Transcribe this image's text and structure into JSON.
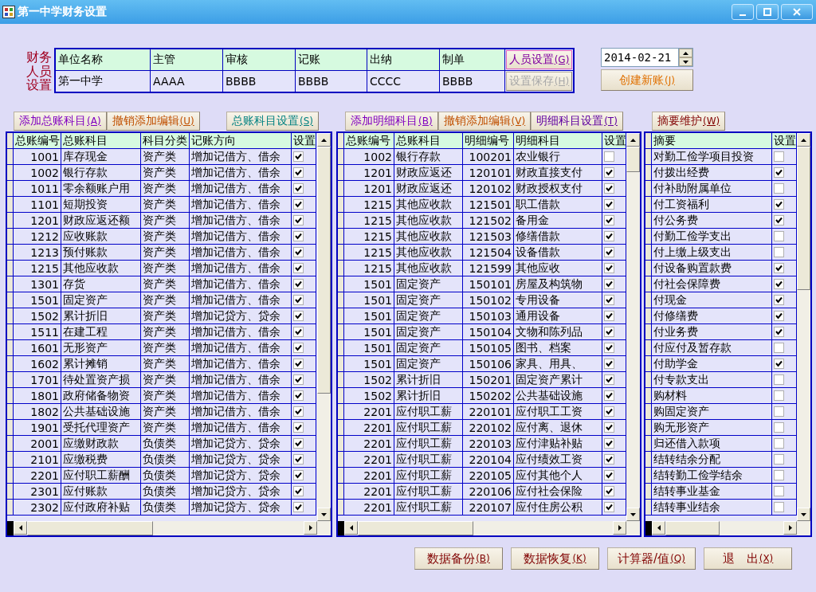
{
  "window": {
    "title": "第一中学财务设置"
  },
  "staff": {
    "label": "财务人员设置",
    "columns": [
      "单位名称",
      "主管",
      "审核",
      "记账",
      "出纳",
      "制单"
    ],
    "values": [
      "第一中学",
      "AAAA",
      "BBBB",
      "BBBB",
      "CCCC",
      "BBBB"
    ],
    "buttons": [
      {
        "label": "人员设置",
        "accel": "(G)",
        "disabled": false,
        "color": "#8000a0"
      },
      {
        "label": "设置保存",
        "accel": "(H)",
        "disabled": true
      }
    ]
  },
  "date": {
    "value": "2014-02-21"
  },
  "create_button": {
    "label": "创建新账",
    "accel": "(J)",
    "color": "#e07000"
  },
  "grids": [
    {
      "buttons": [
        {
          "label": "添加总账科目",
          "accel": "(A)",
          "color": "#8000c0"
        },
        {
          "label": "撤销添加编辑",
          "accel": "(U)",
          "color": "#c05000"
        },
        {
          "label": "总账科目设置",
          "accel": "(S)",
          "color": "#008080"
        }
      ],
      "columns": [
        "总账编号",
        "总账科目",
        "科目分类",
        "记账方向",
        "设置"
      ],
      "rows": [
        {
          "cells": [
            "1001",
            "库存现金",
            "资产类",
            "增加记借方、借余"
          ],
          "checked": true
        },
        {
          "cells": [
            "1002",
            "银行存款",
            "资产类",
            "增加记借方、借余"
          ],
          "checked": true
        },
        {
          "cells": [
            "1011",
            "零余额账户用",
            "资产类",
            "增加记借方、借余"
          ],
          "checked": true
        },
        {
          "cells": [
            "1101",
            "短期投资",
            "资产类",
            "增加记借方、借余"
          ],
          "checked": true
        },
        {
          "cells": [
            "1201",
            "财政应返还额",
            "资产类",
            "增加记借方、借余"
          ],
          "checked": true
        },
        {
          "cells": [
            "1212",
            "应收账款",
            "资产类",
            "增加记借方、借余"
          ],
          "checked": true
        },
        {
          "cells": [
            "1213",
            "预付账款",
            "资产类",
            "增加记借方、借余"
          ],
          "checked": true
        },
        {
          "cells": [
            "1215",
            "其他应收款",
            "资产类",
            "增加记借方、借余"
          ],
          "checked": true
        },
        {
          "cells": [
            "1301",
            "存货",
            "资产类",
            "增加记借方、借余"
          ],
          "checked": true
        },
        {
          "cells": [
            "1501",
            "固定资产",
            "资产类",
            "增加记借方、借余"
          ],
          "checked": true
        },
        {
          "cells": [
            "1502",
            "累计折旧",
            "资产类",
            "增加记贷方、贷余"
          ],
          "checked": true
        },
        {
          "cells": [
            "1511",
            "在建工程",
            "资产类",
            "增加记借方、借余"
          ],
          "checked": true
        },
        {
          "cells": [
            "1601",
            "无形资产",
            "资产类",
            "增加记借方、借余"
          ],
          "checked": true
        },
        {
          "cells": [
            "1602",
            "累计摊销",
            "资产类",
            "增加记借方、借余"
          ],
          "checked": true
        },
        {
          "cells": [
            "1701",
            "待处置资产损",
            "资产类",
            "增加记借方、借余"
          ],
          "checked": true
        },
        {
          "cells": [
            "1801",
            "政府储备物资",
            "资产类",
            "增加记借方、借余"
          ],
          "checked": true
        },
        {
          "cells": [
            "1802",
            "公共基础设施",
            "资产类",
            "增加记借方、借余"
          ],
          "checked": true
        },
        {
          "cells": [
            "1901",
            "受托代理资产",
            "资产类",
            "增加记借方、借余"
          ],
          "checked": true
        },
        {
          "cells": [
            "2001",
            "应缴财政款",
            "负债类",
            "增加记贷方、贷余"
          ],
          "checked": true
        },
        {
          "cells": [
            "2101",
            "应缴税费",
            "负债类",
            "增加记贷方、贷余"
          ],
          "checked": true
        },
        {
          "cells": [
            "2201",
            "应付职工薪酬",
            "负债类",
            "增加记贷方、贷余"
          ],
          "checked": true
        },
        {
          "cells": [
            "2301",
            "应付账款",
            "负债类",
            "增加记贷方、贷余"
          ],
          "checked": true
        },
        {
          "cells": [
            "2302",
            "应付政府补贴",
            "负债类",
            "增加记贷方、贷余"
          ],
          "checked": true
        }
      ]
    },
    {
      "buttons": [
        {
          "label": "添加明细科目",
          "accel": "(B)",
          "color": "#8000c0"
        },
        {
          "label": "撤销添加编辑",
          "accel": "(V)",
          "color": "#c05000"
        },
        {
          "label": "明细科目设置",
          "accel": "(T)",
          "color": "#6000a0"
        }
      ],
      "columns": [
        "总账编号",
        "总账科目",
        "明细编号",
        "明细科目",
        "设置"
      ],
      "rows": [
        {
          "cells": [
            "1002",
            "银行存款",
            "100201",
            "农业银行"
          ],
          "checked": false
        },
        {
          "cells": [
            "1201",
            "财政应返还",
            "120101",
            "财政直接支付"
          ],
          "checked": true
        },
        {
          "cells": [
            "1201",
            "财政应返还",
            "120102",
            "财政授权支付"
          ],
          "checked": true
        },
        {
          "cells": [
            "1215",
            "其他应收款",
            "121501",
            "职工借款"
          ],
          "checked": true
        },
        {
          "cells": [
            "1215",
            "其他应收款",
            "121502",
            "备用金"
          ],
          "checked": true
        },
        {
          "cells": [
            "1215",
            "其他应收款",
            "121503",
            "修缮借款"
          ],
          "checked": true
        },
        {
          "cells": [
            "1215",
            "其他应收款",
            "121504",
            "设备借款"
          ],
          "checked": true
        },
        {
          "cells": [
            "1215",
            "其他应收款",
            "121599",
            "其他应收"
          ],
          "checked": true
        },
        {
          "cells": [
            "1501",
            "固定资产",
            "150101",
            "房屋及构筑物"
          ],
          "checked": true
        },
        {
          "cells": [
            "1501",
            "固定资产",
            "150102",
            "专用设备"
          ],
          "checked": true
        },
        {
          "cells": [
            "1501",
            "固定资产",
            "150103",
            "通用设备"
          ],
          "checked": true
        },
        {
          "cells": [
            "1501",
            "固定资产",
            "150104",
            "文物和陈列品"
          ],
          "checked": true
        },
        {
          "cells": [
            "1501",
            "固定资产",
            "150105",
            "图书、档案"
          ],
          "checked": true
        },
        {
          "cells": [
            "1501",
            "固定资产",
            "150106",
            "家具、用具、"
          ],
          "checked": true
        },
        {
          "cells": [
            "1502",
            "累计折旧",
            "150201",
            "固定资产累计"
          ],
          "checked": true
        },
        {
          "cells": [
            "1502",
            "累计折旧",
            "150202",
            "公共基础设施"
          ],
          "checked": true
        },
        {
          "cells": [
            "2201",
            "应付职工薪",
            "220101",
            "应付职工工资"
          ],
          "checked": true
        },
        {
          "cells": [
            "2201",
            "应付职工薪",
            "220102",
            "应付离、退休"
          ],
          "checked": true
        },
        {
          "cells": [
            "2201",
            "应付职工薪",
            "220103",
            "应付津贴补贴"
          ],
          "checked": true
        },
        {
          "cells": [
            "2201",
            "应付职工薪",
            "220104",
            "应付绩效工资"
          ],
          "checked": true
        },
        {
          "cells": [
            "2201",
            "应付职工薪",
            "220105",
            "应付其他个人"
          ],
          "checked": true
        },
        {
          "cells": [
            "2201",
            "应付职工薪",
            "220106",
            "应付社会保险"
          ],
          "checked": true
        },
        {
          "cells": [
            "2201",
            "应付职工薪",
            "220107",
            "应付住房公积"
          ],
          "checked": true
        }
      ]
    },
    {
      "buttons": [
        {
          "label": "摘要维护",
          "accel": "(W)",
          "color": "#800000"
        }
      ],
      "columns": [
        "摘要",
        "设置"
      ],
      "rows": [
        {
          "cells": [
            "对勤工俭学项目投资"
          ],
          "checked": false
        },
        {
          "cells": [
            "付拨出经费"
          ],
          "checked": true
        },
        {
          "cells": [
            "付补助附属单位"
          ],
          "checked": false
        },
        {
          "cells": [
            "付工资福利"
          ],
          "checked": true
        },
        {
          "cells": [
            "付公务费"
          ],
          "checked": true
        },
        {
          "cells": [
            "付勤工俭学支出"
          ],
          "checked": false
        },
        {
          "cells": [
            "付上缴上级支出"
          ],
          "checked": false
        },
        {
          "cells": [
            "付设备购置款费"
          ],
          "checked": true
        },
        {
          "cells": [
            "付社会保障费"
          ],
          "checked": true
        },
        {
          "cells": [
            "付现金"
          ],
          "checked": true
        },
        {
          "cells": [
            "付修缮费"
          ],
          "checked": true
        },
        {
          "cells": [
            "付业务费"
          ],
          "checked": true
        },
        {
          "cells": [
            "付应付及暂存款"
          ],
          "checked": false
        },
        {
          "cells": [
            "付助学金"
          ],
          "checked": true
        },
        {
          "cells": [
            "付专款支出"
          ],
          "checked": false
        },
        {
          "cells": [
            "购材料"
          ],
          "checked": false
        },
        {
          "cells": [
            "购固定资产"
          ],
          "checked": false
        },
        {
          "cells": [
            "购无形资产"
          ],
          "checked": false
        },
        {
          "cells": [
            "归还借入款项"
          ],
          "checked": false
        },
        {
          "cells": [
            "结转结余分配"
          ],
          "checked": false
        },
        {
          "cells": [
            "结转勤工俭学结余"
          ],
          "checked": false
        },
        {
          "cells": [
            "结转事业基金"
          ],
          "checked": false
        },
        {
          "cells": [
            "结转事业结余"
          ],
          "checked": false
        }
      ]
    }
  ],
  "footer_buttons": [
    {
      "label": "数据备份",
      "accel": "(B)",
      "color": "#800000"
    },
    {
      "label": "数据恢复",
      "accel": "(K)",
      "color": "#800000"
    },
    {
      "label": "计算器/值",
      "accel": "(Q)",
      "color": "#800000"
    },
    {
      "label": "退　出",
      "accel": "(X)",
      "color": "#800000"
    }
  ]
}
